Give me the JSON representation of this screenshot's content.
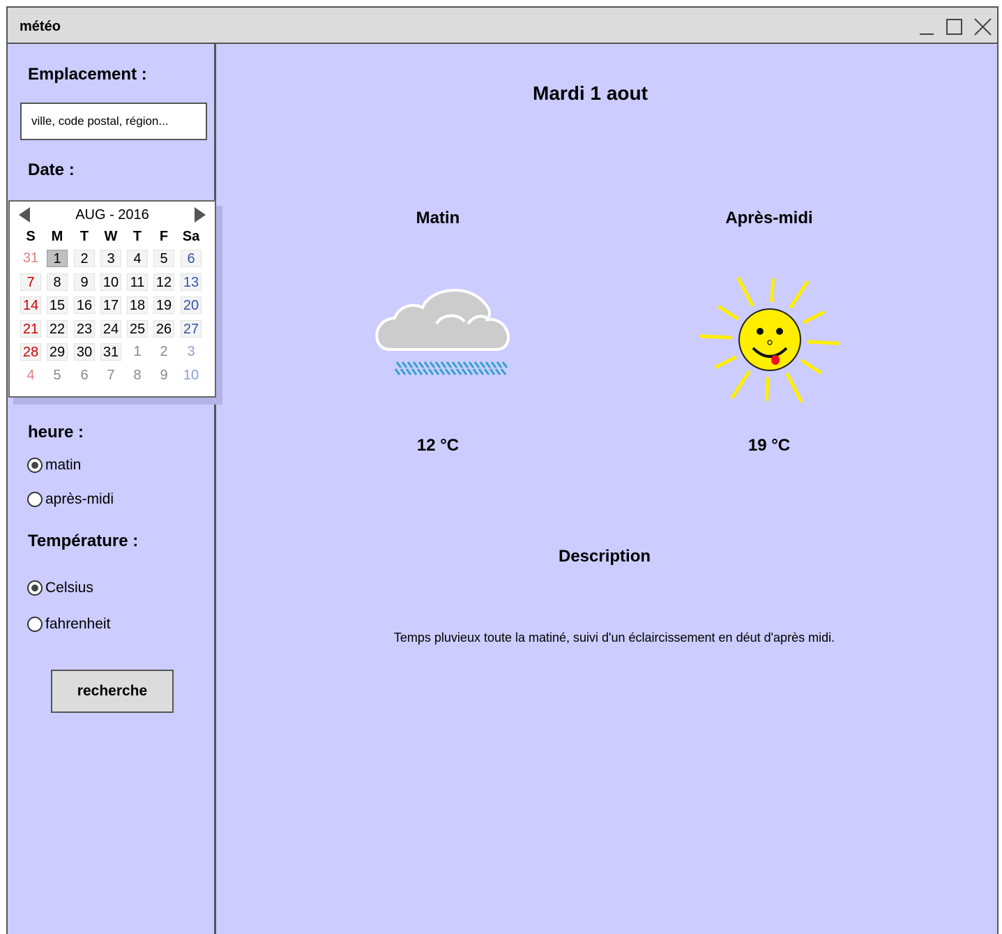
{
  "window": {
    "title": "météo",
    "controls": [
      "minimize-icon",
      "maximize-icon",
      "close-icon"
    ]
  },
  "sidebar": {
    "location_label": "Emplacement :",
    "location_placeholder": "ville, code postal, région...",
    "date_label": "Date :",
    "calendar": {
      "month_label": "AUG - 2016",
      "weekdays": [
        "S",
        "M",
        "T",
        "W",
        "T",
        "F",
        "Sa"
      ],
      "weeks": [
        [
          "31",
          "1",
          "2",
          "3",
          "4",
          "5",
          "6"
        ],
        [
          "7",
          "8",
          "9",
          "10",
          "11",
          "12",
          "13"
        ],
        [
          "14",
          "15",
          "16",
          "17",
          "18",
          "19",
          "20"
        ],
        [
          "21",
          "22",
          "23",
          "24",
          "25",
          "26",
          "27"
        ],
        [
          "28",
          "29",
          "30",
          "31",
          "1",
          "2",
          "3"
        ],
        [
          "4",
          "5",
          "6",
          "7",
          "8",
          "9",
          "10"
        ]
      ],
      "selected": "1",
      "colors": {
        "sunday": "#cc0000",
        "saturday": "#3355aa",
        "other_month": "#888888"
      }
    },
    "hour_label": "heure :",
    "hour_options": [
      {
        "label": "matin",
        "checked": true
      },
      {
        "label": "après-midi",
        "checked": false
      }
    ],
    "temperature_label": "Température :",
    "temperature_options": [
      {
        "label": "Celsius",
        "checked": true
      },
      {
        "label": "fahrenheit",
        "checked": false
      }
    ],
    "search_button": "recherche"
  },
  "main": {
    "date_title": "Mardi 1 aout",
    "morning": {
      "label": "Matin",
      "temperature": "12 °C",
      "icon": "rain-cloud-icon"
    },
    "afternoon": {
      "label": "Après-midi",
      "temperature": "19 °C",
      "icon": "smiling-sun-icon"
    },
    "description_title": "Description",
    "description_text": "Temps pluvieux toute la matiné, suivi d'un éclaircissement en déut d'après midi."
  },
  "colors": {
    "background": "#ccccff",
    "titlebar": "#dcdcdc",
    "border": "#555555"
  }
}
